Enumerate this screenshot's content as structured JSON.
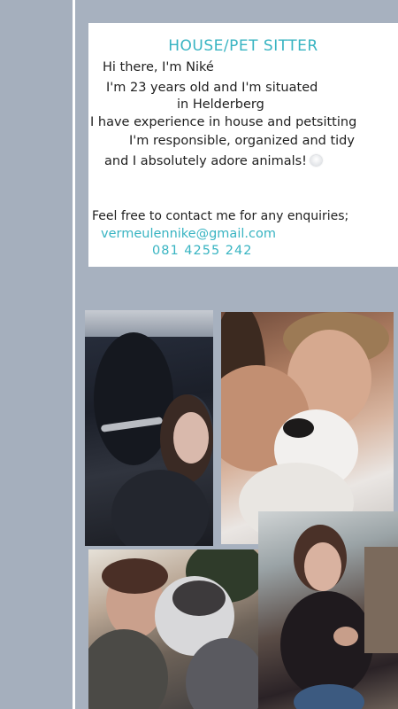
{
  "card": {
    "title": "HOUSE/PET SITTER",
    "lines": [
      "Hi there, I'm Niké",
      "I'm 23 years old and I'm situated",
      "in Helderberg",
      "I have experience in house and petsitting",
      "I'm responsible, organized and tidy",
      "and I absolutely adore animals!"
    ],
    "contact_prompt": "Feel free to contact me for any enquiries;",
    "email": "vermeulennike@gmail.com",
    "phone": "081 4255 242"
  },
  "photos": [
    {
      "name": "woman-with-dark-dog-photo"
    },
    {
      "name": "woman-kissing-white-dog-photo"
    },
    {
      "name": "woman-with-husky-photo"
    },
    {
      "name": "woman-standing-portrait-photo"
    }
  ],
  "colors": {
    "background": "#a7b1bf",
    "accent_teal": "#38b4c2",
    "card_background": "#ffffff"
  },
  "icons": [
    "white-heart-icon"
  ]
}
